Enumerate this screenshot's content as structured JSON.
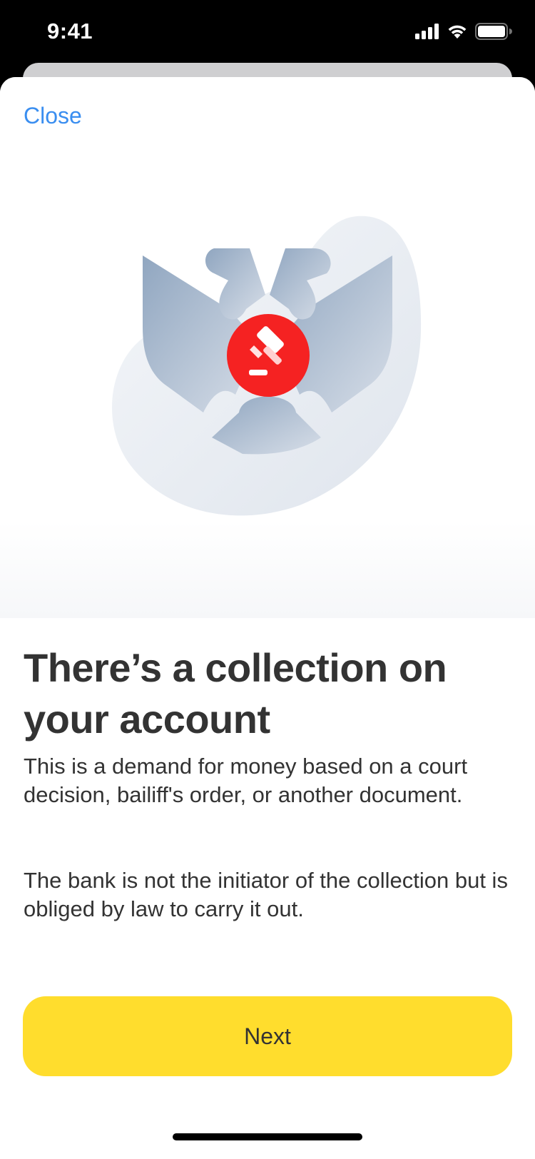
{
  "status_bar": {
    "time": "9:41",
    "icons": [
      "cellular-signal-icon",
      "wifi-icon",
      "battery-icon"
    ]
  },
  "sheet": {
    "close_label": "Close",
    "illustration": {
      "icons": [
        "eagle-emblem-icon",
        "gavel-icon"
      ],
      "colors": {
        "emblem": "#9aaec4",
        "badge": "#f52222",
        "blob": "#e9edf2"
      }
    },
    "title": "There’s a collection on your account",
    "paragraphs": [
      "This is a demand for money based on a court decision, bailiff's order, or another document.",
      "The bank is not the initiator of the collection but is obliged by law to carry it out."
    ],
    "next_label": "Next"
  },
  "colors": {
    "accent_link": "#3a8ef0",
    "primary_button": "#ffdd2d",
    "text": "#333333"
  }
}
